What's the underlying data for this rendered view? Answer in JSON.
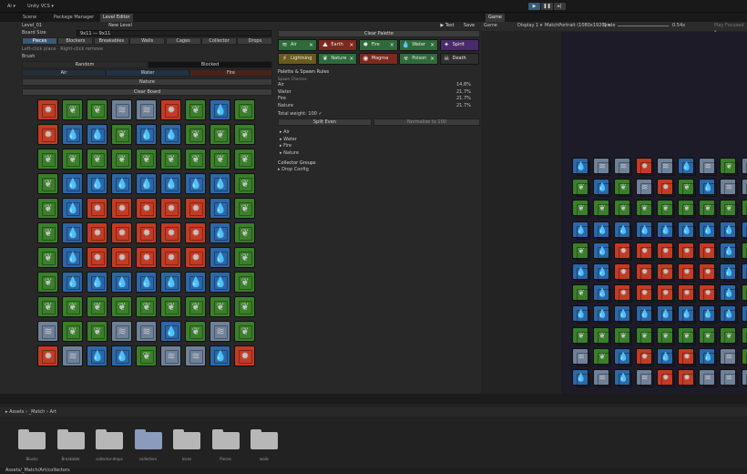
{
  "topbar": {
    "account": "Ai ▾",
    "vcs": "Unity VCS ▾",
    "play_icon": "play-icon",
    "pause_icon": "pause-icon",
    "step_icon": "step-icon"
  },
  "editor_tabs": [
    {
      "label": "Scene",
      "active": false
    },
    {
      "label": "Package Manager",
      "active": false
    },
    {
      "label": "Level Editor",
      "active": true
    }
  ],
  "game_tabs": [
    {
      "label": "Game",
      "active": true
    }
  ],
  "level": {
    "name": "Level_01",
    "new_level": "New Level",
    "test": "Test",
    "save": "Save",
    "board_size_label": "Board Size",
    "board_size_value": "9x11 — 9x11"
  },
  "mode_tabs": [
    "Pieces",
    "Blockers",
    "Breakables",
    "Walls",
    "Cages",
    "Collector",
    "Drops"
  ],
  "hint": "Left-click place · Right-click remove",
  "brush": {
    "label": "Brush",
    "random": "Random",
    "blocked": "Blocked",
    "colors": [
      "Air",
      "Water",
      "Fire"
    ],
    "nature": "Nature",
    "clear_board": "Clear Board"
  },
  "board": {
    "rows": [
      [
        "fire",
        "nature",
        "nature",
        "air",
        "air",
        "fire",
        "nature",
        "water",
        "nature"
      ],
      [
        "fire",
        "water",
        "water",
        "nature",
        "water",
        "water",
        "nature",
        "nature",
        "nature"
      ],
      [
        "nature",
        "nature",
        "nature",
        "nature",
        "nature",
        "nature",
        "nature",
        "nature",
        "nature"
      ],
      [
        "nature",
        "water",
        "water",
        "water",
        "water",
        "water",
        "water",
        "water",
        "nature"
      ],
      [
        "nature",
        "water",
        "fire",
        "fire",
        "fire",
        "fire",
        "fire",
        "water",
        "nature"
      ],
      [
        "nature",
        "water",
        "fire",
        "fire",
        "fire",
        "fire",
        "fire",
        "water",
        "nature"
      ],
      [
        "nature",
        "water",
        "fire",
        "fire",
        "fire",
        "fire",
        "fire",
        "water",
        "nature"
      ],
      [
        "nature",
        "water",
        "water",
        "water",
        "water",
        "water",
        "water",
        "water",
        "nature"
      ],
      [
        "nature",
        "nature",
        "nature",
        "nature",
        "nature",
        "nature",
        "nature",
        "nature",
        "nature"
      ],
      [
        "air",
        "nature",
        "nature",
        "air",
        "air",
        "water",
        "nature",
        "air",
        "nature"
      ],
      [
        "fire",
        "air",
        "water",
        "water",
        "nature",
        "air",
        "air",
        "water",
        "fire"
      ]
    ]
  },
  "palette": {
    "clear": "Clear Palette",
    "items": [
      {
        "label": "Air",
        "color": "#2f6a3b",
        "icon": "wind-icon",
        "glyph": "≋"
      },
      {
        "label": "Earth",
        "color": "#7c2a1e",
        "icon": "earth-icon",
        "glyph": "⛰"
      },
      {
        "label": "Fire",
        "color": "#2f6a3b",
        "icon": "fire-icon",
        "glyph": "✹"
      },
      {
        "label": "Water",
        "color": "#2f6a3b",
        "icon": "water-icon",
        "glyph": "💧"
      },
      {
        "label": "Spirit",
        "color": "#4b2a6b",
        "icon": "spirit-icon",
        "glyph": "✦"
      },
      {
        "label": "Lightning",
        "color": "#6a5a1e",
        "icon": "lightning-icon",
        "glyph": "⚡"
      },
      {
        "label": "Nature",
        "color": "#2f6a3b",
        "icon": "leaf-icon",
        "glyph": "❦"
      },
      {
        "label": "Magma",
        "color": "#7c2a1e",
        "icon": "magma-icon",
        "glyph": "◉"
      },
      {
        "label": "Poison",
        "color": "#2f6a3b",
        "icon": "poison-icon",
        "glyph": "☣"
      },
      {
        "label": "Death",
        "color": "#2f2f2f",
        "icon": "skull-icon",
        "glyph": "☠"
      }
    ]
  },
  "spawn": {
    "title": "Palette & Spawn Rules",
    "subtitle": "Spawn Chances",
    "rows": [
      {
        "label": "Air",
        "value": "14.8%"
      },
      {
        "label": "Water",
        "value": "21.7%"
      },
      {
        "label": "Fire",
        "value": "21.7%"
      },
      {
        "label": "Nature",
        "value": "21.7%"
      }
    ],
    "total": "Total weight: 100 ✓",
    "split_even": "Split Even",
    "normalize": "Normalize to 100",
    "tree": [
      "▸ Air",
      "▸ Water",
      "▸ Fire",
      "▸ Nature"
    ],
    "collector_groups": "Collector Groups",
    "drop_config": "▸ Drop Config"
  },
  "game": {
    "display_label": "Game",
    "display": "Display 1 ▾",
    "resolution": "MatchPortrait (1080x1920) ▾",
    "scale_label": "Scale",
    "scale_value": "0.54x",
    "play_focused": "Play Focused ▾",
    "rows": [
      [
        "water",
        "air",
        "air",
        "fire",
        "air",
        "water",
        "air",
        "nature",
        "air"
      ],
      [
        "nature",
        "water",
        "nature",
        "air",
        "fire",
        "nature",
        "water",
        "air",
        "air"
      ],
      [
        "nature",
        "nature",
        "nature",
        "nature",
        "nature",
        "nature",
        "nature",
        "nature",
        "nature"
      ],
      [
        "water",
        "water",
        "water",
        "water",
        "water",
        "water",
        "water",
        "water",
        "water"
      ],
      [
        "nature",
        "water",
        "fire",
        "fire",
        "fire",
        "fire",
        "fire",
        "water",
        "nature"
      ],
      [
        "water",
        "water",
        "fire",
        "fire",
        "fire",
        "fire",
        "fire",
        "water",
        "water"
      ],
      [
        "nature",
        "water",
        "fire",
        "fire",
        "fire",
        "fire",
        "fire",
        "water",
        "nature"
      ],
      [
        "water",
        "water",
        "water",
        "water",
        "water",
        "water",
        "water",
        "water",
        "water"
      ],
      [
        "nature",
        "nature",
        "nature",
        "nature",
        "nature",
        "nature",
        "nature",
        "nature",
        "nature"
      ],
      [
        "air",
        "nature",
        "water",
        "fire",
        "water",
        "fire",
        "water",
        "air",
        "nature"
      ],
      [
        "water",
        "air",
        "water",
        "air",
        "fire",
        "fire",
        "air",
        "air",
        "air"
      ]
    ]
  },
  "project": {
    "breadcrumb": [
      "Assets",
      "_Match",
      "Art"
    ],
    "path": "Assets/_Match/Art/collectors",
    "folders": [
      "Blocks",
      "Breakable",
      "collector-drops",
      "collectors",
      "Icons",
      "Pieces",
      "walls"
    ],
    "selected": "collectors"
  },
  "tile_colors": {
    "air": "#6e8199",
    "water": "#2d67a8",
    "fire": "#c33b24",
    "nature": "#3a7f2a"
  },
  "glyphs": {
    "air": "≋",
    "water": "💧",
    "fire": "✹",
    "nature": "❦"
  }
}
